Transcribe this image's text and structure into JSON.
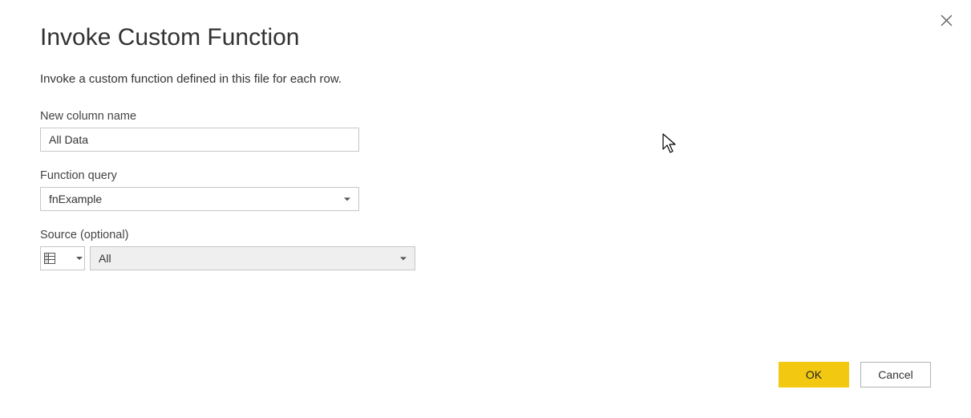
{
  "dialog": {
    "title": "Invoke Custom Function",
    "subtitle": "Invoke a custom function defined in this file for each row."
  },
  "fields": {
    "newColumnName": {
      "label": "New column name",
      "value": "All Data"
    },
    "functionQuery": {
      "label": "Function query",
      "value": "fnExample"
    },
    "source": {
      "label": "Source (optional)",
      "value": "All"
    }
  },
  "buttons": {
    "ok": "OK",
    "cancel": "Cancel"
  }
}
